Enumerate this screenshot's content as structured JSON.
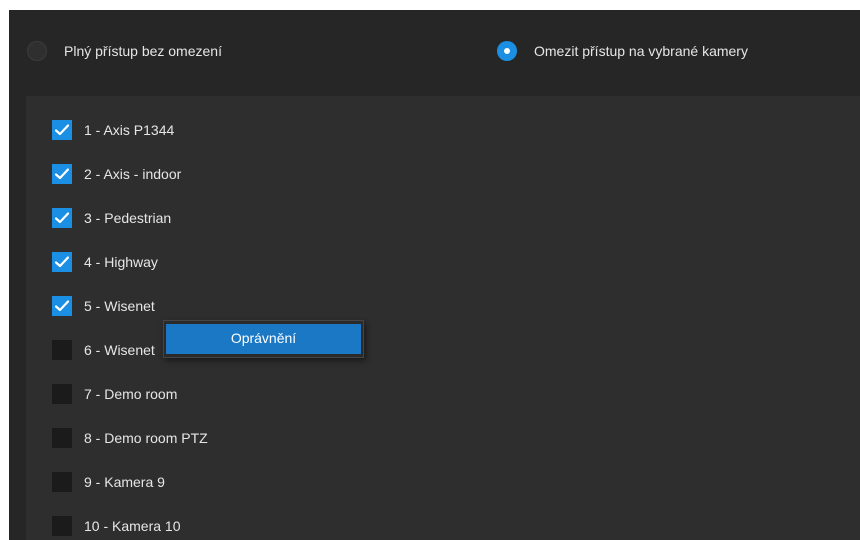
{
  "access_mode": {
    "options": [
      {
        "label": "Plný přístup bez omezení",
        "selected": false
      },
      {
        "label": "Omezit přístup na vybrané kamery",
        "selected": true
      }
    ]
  },
  "cameras": [
    {
      "label": "1 - Axis P1344",
      "checked": true
    },
    {
      "label": "2 - Axis - indoor",
      "checked": true
    },
    {
      "label": "3 - Pedestrian",
      "checked": true
    },
    {
      "label": "4 - Highway",
      "checked": true
    },
    {
      "label": "5 - Wisenet",
      "checked": true
    },
    {
      "label": "6 - Wisenet",
      "checked": false
    },
    {
      "label": "7 - Demo room",
      "checked": false
    },
    {
      "label": "8 - Demo room PTZ",
      "checked": false
    },
    {
      "label": "9 - Kamera 9",
      "checked": false
    },
    {
      "label": "10 - Kamera 10",
      "checked": false
    }
  ],
  "context_menu": {
    "items": [
      {
        "label": "Oprávnění",
        "highlighted": true
      }
    ]
  },
  "colors": {
    "accent": "#1a8fe3",
    "menu_highlight": "#1b78c4",
    "background": "#262626",
    "panel": "#2e2e2e",
    "text": "#e6e6e6"
  }
}
